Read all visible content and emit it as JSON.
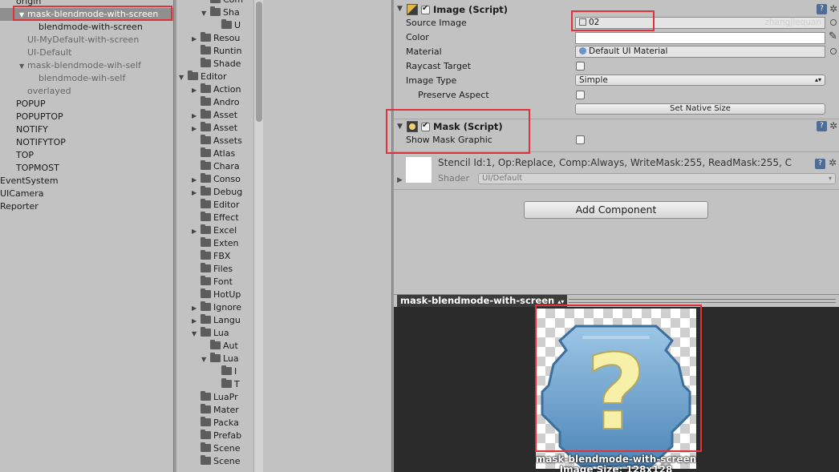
{
  "hierarchy": {
    "rows": [
      {
        "label": "origin",
        "indent": 1,
        "dim": false
      },
      {
        "label": "mask-blendmode-with-screen",
        "indent": 2,
        "dim": false,
        "expanded": true,
        "selected": true
      },
      {
        "label": "blendmode-with-screen",
        "indent": 3,
        "dim": false
      },
      {
        "label": "UI-MyDefault-with-screen",
        "indent": 2,
        "dim": true
      },
      {
        "label": "UI-Default",
        "indent": 2,
        "dim": true
      },
      {
        "label": "mask-blendmode-wih-self",
        "indent": 2,
        "dim": true,
        "expanded": true
      },
      {
        "label": "blendmode-wih-self",
        "indent": 3,
        "dim": true
      },
      {
        "label": "overlayed",
        "indent": 2,
        "dim": true
      },
      {
        "label": "POPUP",
        "indent": 1,
        "dim": false
      },
      {
        "label": "POPUPTOP",
        "indent": 1,
        "dim": false
      },
      {
        "label": "NOTIFY",
        "indent": 1,
        "dim": false
      },
      {
        "label": "NOTIFYTOP",
        "indent": 1,
        "dim": false
      },
      {
        "label": "TOP",
        "indent": 1,
        "dim": false
      },
      {
        "label": "TOPMOST",
        "indent": 1,
        "dim": false
      },
      {
        "label": "EventSystem",
        "indent": 0,
        "dim": false
      },
      {
        "label": "UICamera",
        "indent": 0,
        "dim": false
      },
      {
        "label": "Reporter",
        "indent": 0,
        "dim": false
      }
    ]
  },
  "project": {
    "rows": [
      {
        "label": "Com",
        "indent": 2,
        "arrow": "none"
      },
      {
        "label": "Sha",
        "indent": 2,
        "arrow": "down"
      },
      {
        "label": "U",
        "indent": 3,
        "arrow": "none"
      },
      {
        "label": "Resou",
        "indent": 1,
        "arrow": "right"
      },
      {
        "label": "Runtin",
        "indent": 1,
        "arrow": "none"
      },
      {
        "label": "Shade",
        "indent": 1,
        "arrow": "none"
      },
      {
        "label": "Editor",
        "indent": 0,
        "arrow": "down"
      },
      {
        "label": "Action",
        "indent": 1,
        "arrow": "right"
      },
      {
        "label": "Andro",
        "indent": 1,
        "arrow": "none"
      },
      {
        "label": "Asset",
        "indent": 1,
        "arrow": "right"
      },
      {
        "label": "Asset",
        "indent": 1,
        "arrow": "right"
      },
      {
        "label": "Assets",
        "indent": 1,
        "arrow": "none"
      },
      {
        "label": "Atlas",
        "indent": 1,
        "arrow": "none"
      },
      {
        "label": "Chara",
        "indent": 1,
        "arrow": "none"
      },
      {
        "label": "Conso",
        "indent": 1,
        "arrow": "right"
      },
      {
        "label": "Debug",
        "indent": 1,
        "arrow": "right"
      },
      {
        "label": "Editor",
        "indent": 1,
        "arrow": "none"
      },
      {
        "label": "Effect",
        "indent": 1,
        "arrow": "none"
      },
      {
        "label": "Excel",
        "indent": 1,
        "arrow": "right"
      },
      {
        "label": "Exten",
        "indent": 1,
        "arrow": "none"
      },
      {
        "label": "FBX",
        "indent": 1,
        "arrow": "none"
      },
      {
        "label": "Files",
        "indent": 1,
        "arrow": "none"
      },
      {
        "label": "Font",
        "indent": 1,
        "arrow": "none"
      },
      {
        "label": "HotUp",
        "indent": 1,
        "arrow": "none"
      },
      {
        "label": "Ignore",
        "indent": 1,
        "arrow": "right"
      },
      {
        "label": "Langu",
        "indent": 1,
        "arrow": "right"
      },
      {
        "label": "Lua",
        "indent": 1,
        "arrow": "down"
      },
      {
        "label": "Aut",
        "indent": 2,
        "arrow": "none"
      },
      {
        "label": "Lua",
        "indent": 2,
        "arrow": "down"
      },
      {
        "label": "I",
        "indent": 3,
        "arrow": "none"
      },
      {
        "label": "T",
        "indent": 3,
        "arrow": "none"
      },
      {
        "label": "LuaPr",
        "indent": 1,
        "arrow": "none"
      },
      {
        "label": "Mater",
        "indent": 1,
        "arrow": "none"
      },
      {
        "label": "Packa",
        "indent": 1,
        "arrow": "none"
      },
      {
        "label": "Prefab",
        "indent": 1,
        "arrow": "none"
      },
      {
        "label": "Scene",
        "indent": 1,
        "arrow": "none"
      },
      {
        "label": "Scene",
        "indent": 1,
        "arrow": "none"
      }
    ]
  },
  "inspector": {
    "image": {
      "title": "Image (Script)",
      "enabled": true,
      "source_image_label": "Source Image",
      "source_image_value": "02",
      "color_label": "Color",
      "material_label": "Material",
      "material_value": "Default UI Material",
      "raycast_label": "Raycast Target",
      "image_type_label": "Image Type",
      "image_type_value": "Simple",
      "preserve_label": "Preserve Aspect",
      "native_size_button": "Set Native Size",
      "watermark": "zhangjiequan"
    },
    "mask": {
      "title": "Mask (Script)",
      "enabled": true,
      "show_graphic_label": "Show Mask Graphic"
    },
    "material_block": {
      "stencil_text": "Stencil Id:1, Op:Replace, Comp:Always, WriteMask:255, ReadMask:255, C",
      "shader_label": "Shader",
      "shader_value": "UI/Default"
    },
    "add_component_button": "Add Component"
  },
  "preview": {
    "title": "mask-blendmode-with-screen",
    "caption_line1": "mask-blendmode-with-screen",
    "caption_line2": "Image Size: 128x128"
  },
  "colors": {
    "highlight_red": "#e0323b",
    "selection": "#8f8f8f",
    "panel": "#c2c2c2",
    "preview_bg": "#2b2b2b",
    "icon_blue": "#6fa8d8"
  }
}
